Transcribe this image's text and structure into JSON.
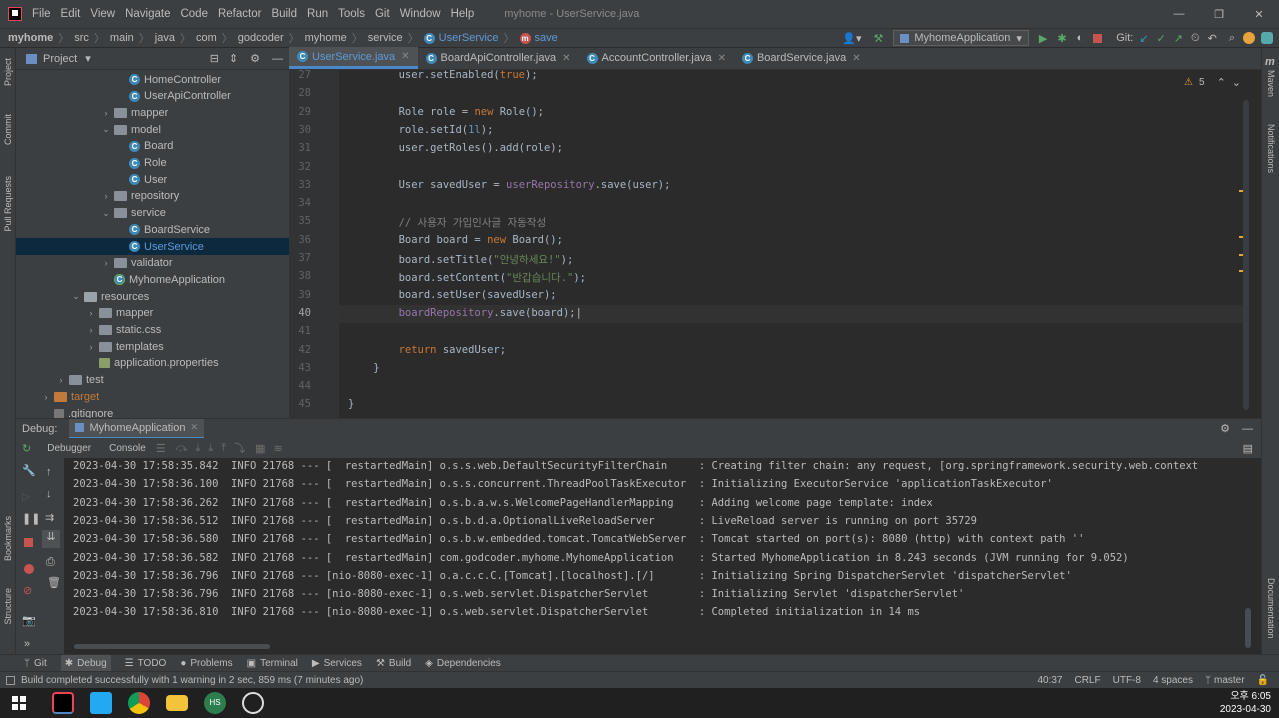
{
  "titlebar": {
    "app_icon": "intellij-icon",
    "menu": [
      "File",
      "Edit",
      "View",
      "Navigate",
      "Code",
      "Refactor",
      "Build",
      "Run",
      "Tools",
      "Git",
      "Window",
      "Help"
    ],
    "window_title": "myhome - UserService.java"
  },
  "breadcrumb": [
    "myhome",
    "src",
    "main",
    "java",
    "com",
    "godcoder",
    "myhome",
    "service",
    "UserService",
    "save"
  ],
  "run_config": "MyhomeApplication",
  "git_label": "Git:",
  "project_panel": {
    "title": "Project",
    "items": [
      {
        "label": "HomeController",
        "kind": "class",
        "indent": 6
      },
      {
        "label": "UserApiController",
        "kind": "class",
        "indent": 6
      },
      {
        "label": "mapper",
        "kind": "folder",
        "indent": 5,
        "chev": "›"
      },
      {
        "label": "model",
        "kind": "folder",
        "indent": 5,
        "chev": "⌄"
      },
      {
        "label": "Board",
        "kind": "class",
        "indent": 6
      },
      {
        "label": "Role",
        "kind": "class",
        "indent": 6
      },
      {
        "label": "User",
        "kind": "class",
        "indent": 6
      },
      {
        "label": "repository",
        "kind": "folder",
        "indent": 5,
        "chev": "›"
      },
      {
        "label": "service",
        "kind": "folder",
        "indent": 5,
        "chev": "⌄"
      },
      {
        "label": "BoardService",
        "kind": "class",
        "indent": 6
      },
      {
        "label": "UserService",
        "kind": "class",
        "indent": 6,
        "selected": true
      },
      {
        "label": "validator",
        "kind": "folder",
        "indent": 5,
        "chev": "›"
      },
      {
        "label": "MyhomeApplication",
        "kind": "app",
        "indent": 5
      },
      {
        "label": "resources",
        "kind": "resfolder",
        "indent": 3,
        "chev": "⌄"
      },
      {
        "label": "mapper",
        "kind": "folder",
        "indent": 4,
        "chev": "›"
      },
      {
        "label": "static.css",
        "kind": "folder",
        "indent": 4,
        "chev": "›"
      },
      {
        "label": "templates",
        "kind": "folder",
        "indent": 4,
        "chev": "›"
      },
      {
        "label": "application.properties",
        "kind": "props",
        "indent": 4
      },
      {
        "label": "test",
        "kind": "folder",
        "indent": 2,
        "chev": "›"
      },
      {
        "label": "target",
        "kind": "orangefolder",
        "indent": 1,
        "chev": "›"
      },
      {
        "label": ".gitignore",
        "kind": "file",
        "indent": 1
      }
    ]
  },
  "tabs": [
    {
      "label": "UserService.java",
      "active": true
    },
    {
      "label": "BoardApiController.java",
      "active": false
    },
    {
      "label": "AccountController.java",
      "active": false
    },
    {
      "label": "BoardService.java",
      "active": false
    }
  ],
  "warnings": "5",
  "code_lines": [
    {
      "n": "27",
      "html": "        user.setEnabled(<span class='kw'>true</span>);"
    },
    {
      "n": "28",
      "html": ""
    },
    {
      "n": "29",
      "html": "        Role role = <span class='kw'>new</span> Role();"
    },
    {
      "n": "30",
      "html": "        role.setId(<span class='num'>1l</span>);"
    },
    {
      "n": "31",
      "html": "        user.getRoles().add(role);"
    },
    {
      "n": "32",
      "html": ""
    },
    {
      "n": "33",
      "html": "        User savedUser = <span class='fld'>userRepository</span>.save(user);"
    },
    {
      "n": "34",
      "html": ""
    },
    {
      "n": "35",
      "html": "        <span class='cmt'>// 사용자 가입인사글 자동작성</span>"
    },
    {
      "n": "36",
      "html": "        Board board = <span class='kw'>new</span> Board();"
    },
    {
      "n": "37",
      "html": "        board.setTitle(<span class='str'>\"안녕하세요!\"</span>);"
    },
    {
      "n": "38",
      "html": "        board.setContent(<span class='str'>\"반갑습니다.\"</span>);"
    },
    {
      "n": "39",
      "html": "        board.setUser(savedUser);"
    },
    {
      "n": "40",
      "html": "        <span class='fld'>boardRepository</span>.save(board);"
    },
    {
      "n": "41",
      "html": ""
    },
    {
      "n": "42",
      "html": "        <span class='kw'>return</span> savedUser;"
    },
    {
      "n": "43",
      "html": "    }"
    },
    {
      "n": "44",
      "html": ""
    },
    {
      "n": "45",
      "html": "}"
    }
  ],
  "current_line": "40",
  "debug": {
    "label": "Debug:",
    "session_tab": "MyhomeApplication",
    "debugger_tab": "Debugger",
    "console_tab": "Console"
  },
  "log_lines": [
    "2023-04-30 17:58:35.842  INFO 21768 --- [  restartedMain] o.s.s.web.DefaultSecurityFilterChain     : Creating filter chain: any request, [org.springframework.security.web.context",
    "2023-04-30 17:58:36.100  INFO 21768 --- [  restartedMain] o.s.s.concurrent.ThreadPoolTaskExecutor  : Initializing ExecutorService 'applicationTaskExecutor'",
    "2023-04-30 17:58:36.262  INFO 21768 --- [  restartedMain] o.s.b.a.w.s.WelcomePageHandlerMapping    : Adding welcome page template: index",
    "2023-04-30 17:58:36.512  INFO 21768 --- [  restartedMain] o.s.b.d.a.OptionalLiveReloadServer       : LiveReload server is running on port 35729",
    "2023-04-30 17:58:36.580  INFO 21768 --- [  restartedMain] o.s.b.w.embedded.tomcat.TomcatWebServer  : Tomcat started on port(s): 8080 (http) with context path ''",
    "2023-04-30 17:58:36.582  INFO 21768 --- [  restartedMain] com.godcoder.myhome.MyhomeApplication    : Started MyhomeApplication in 8.243 seconds (JVM running for 9.052)",
    "2023-04-30 17:58:36.796  INFO 21768 --- [nio-8080-exec-1] o.a.c.c.C.[Tomcat].[localhost].[/]       : Initializing Spring DispatcherServlet 'dispatcherServlet'",
    "2023-04-30 17:58:36.796  INFO 21768 --- [nio-8080-exec-1] o.s.web.servlet.DispatcherServlet        : Initializing Servlet 'dispatcherServlet'",
    "2023-04-30 17:58:36.810  INFO 21768 --- [nio-8080-exec-1] o.s.web.servlet.DispatcherServlet        : Completed initialization in 14 ms"
  ],
  "left_strip": [
    "Project",
    "Commit",
    "Pull Requests",
    "Bookmarks",
    "Structure"
  ],
  "right_strip": [
    "Maven",
    "Notifications",
    "Documentation"
  ],
  "tool_windows": [
    "Git",
    "Debug",
    "TODO",
    "Problems",
    "Terminal",
    "Services",
    "Build",
    "Dependencies"
  ],
  "status": {
    "message": "Build completed successfully with 1 warning in 2 sec, 859 ms (7 minutes ago)",
    "position": "40:37",
    "line_sep": "CRLF",
    "encoding": "UTF-8",
    "indent": "4 spaces",
    "branch": "master"
  },
  "taskbar": {
    "time": "오후 6:05",
    "date": "2023-04-30"
  },
  "colors": {
    "accent": "#4a88c7",
    "selection": "#0d293e",
    "bg": "#2b2b2b",
    "panel": "#3c3f41"
  }
}
